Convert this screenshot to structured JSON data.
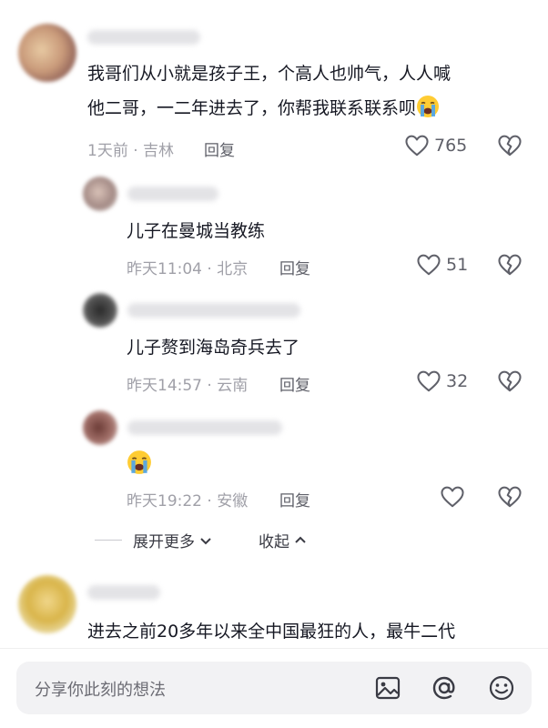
{
  "comments": [
    {
      "text_line1": "我哥们从小就是孩子王，个高人也帅气，人人喊",
      "text_line2": "他二哥，一二年进去了，你帮我联系联系呗",
      "emoji": "loudly-crying-face",
      "time": "1天前",
      "location": "吉林",
      "reply_label": "回复",
      "likes": "765"
    }
  ],
  "replies": [
    {
      "text": "儿子在曼城当教练",
      "time": "昨天11:04",
      "location": "北京",
      "reply_label": "回复",
      "likes": "51"
    },
    {
      "text": "儿子赘到海岛奇兵去了",
      "time": "昨天14:57",
      "location": "云南",
      "reply_label": "回复",
      "likes": "32"
    },
    {
      "emoji": "loudly-crying-face",
      "time": "昨天19:22",
      "location": "安徽",
      "reply_label": "回复",
      "likes": ""
    }
  ],
  "controls": {
    "expand_more": "展开更多",
    "collapse": "收起"
  },
  "next_comment": {
    "text": "进去之前20多年以来全中国最狂的人，最牛二代"
  },
  "input": {
    "placeholder": "分享你此刻的想法"
  },
  "icons": [
    "heart-outline-icon",
    "broken-heart-icon",
    "image-icon",
    "at-icon",
    "emoji-icon",
    "chevron-down-icon",
    "chevron-up-icon"
  ],
  "colors": {
    "text": "#161823",
    "meta": "#a0a0a8",
    "emoji_yellow": "#ffcc33",
    "tear_blue": "#4aa3f0"
  }
}
